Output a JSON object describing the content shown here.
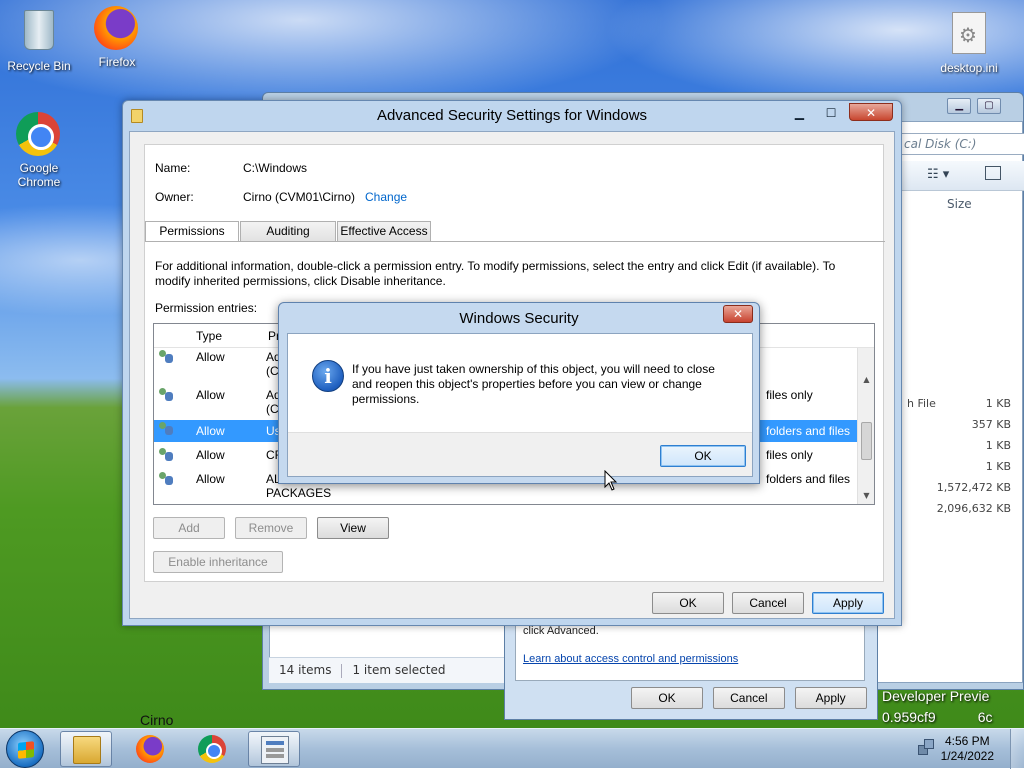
{
  "desktop": {
    "icons": [
      {
        "label": "Recycle Bin",
        "icon": "recycle-bin-icon"
      },
      {
        "label": "Firefox",
        "icon": "firefox-icon"
      },
      {
        "label": "Google Chrome",
        "icon": "chrome-icon"
      },
      {
        "label": "desktop.ini",
        "icon": "settings-file-icon"
      }
    ],
    "bottom_label": "Cirno",
    "watermark_line1": "Developer Previe",
    "watermark_line2": "0.959cf9",
    "watermark_line3": "6c"
  },
  "explorer": {
    "address": "cal Disk (C:)",
    "size_header": "Size",
    "type_fragment": "h File",
    "sizes": [
      "1 KB",
      "357 KB",
      "1 KB",
      "1 KB",
      "1,572,472 KB",
      "2,096,632 KB"
    ],
    "status_items": "14 items",
    "status_selected": "1 item selected"
  },
  "properties": {
    "text": "click Advanced.",
    "link": "Learn about access control and permissions",
    "ok": "OK",
    "cancel": "Cancel",
    "apply": "Apply"
  },
  "advanced": {
    "title": "Advanced Security Settings for Windows",
    "name_label": "Name:",
    "name_value": "C:\\Windows",
    "owner_label": "Owner:",
    "owner_value": "Cirno (CVM01\\Cirno)",
    "change_link": "Change",
    "tabs": [
      "Permissions",
      "Auditing",
      "Effective Access"
    ],
    "info_text": "For additional information, double-click a permission entry. To modify permissions, select the entry and click Edit (if available). To modify inherited permissions, click Disable inheritance.",
    "entries_label": "Permission entries:",
    "columns": {
      "type": "Type",
      "principal": "Pri"
    },
    "rows": [
      {
        "type": "Allow",
        "name": "Ad\n(CV",
        "applies": "",
        "selected": false
      },
      {
        "type": "Allow",
        "name": "Ad\n(CV",
        "applies": "files only",
        "selected": false
      },
      {
        "type": "Allow",
        "name": "Us",
        "applies": "folders and files",
        "selected": true
      },
      {
        "type": "Allow",
        "name": "CR",
        "applies": "files only",
        "selected": false
      },
      {
        "type": "Allow",
        "name": "ALL\nPACKAGES",
        "applies": "folders and files",
        "selected": false
      }
    ],
    "buttons": {
      "add": "Add",
      "remove": "Remove",
      "view": "View",
      "enable_inheritance": "Enable inheritance",
      "ok": "OK",
      "cancel": "Cancel",
      "apply": "Apply"
    }
  },
  "security_dialog": {
    "title": "Windows Security",
    "message": "If you have just taken ownership of this object, you will need to close and reopen this object's properties before you can view or change permissions.",
    "ok": "OK"
  },
  "taskbar": {
    "time": "4:56 PM",
    "date": "1/24/2022"
  }
}
